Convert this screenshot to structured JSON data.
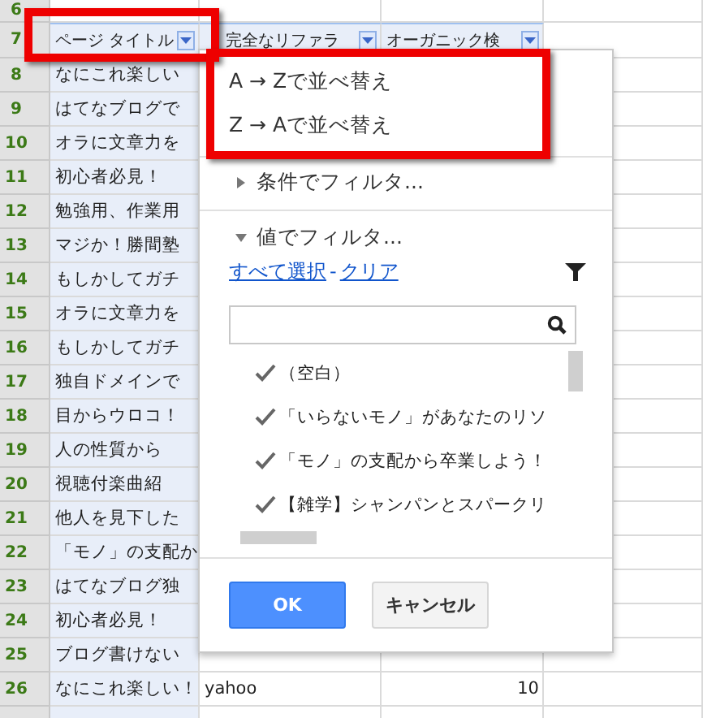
{
  "sheet": {
    "top_row_number": "6",
    "header": {
      "number": "7",
      "columns": [
        "ページ タイトル",
        "完全なリファラ",
        "オーガニック検"
      ]
    },
    "rows": [
      {
        "number": "8",
        "cells": [
          "なにこれ楽しい"
        ]
      },
      {
        "number": "9",
        "cells": [
          "はてなブログで"
        ]
      },
      {
        "number": "10",
        "cells": [
          "オラに文章力を"
        ]
      },
      {
        "number": "11",
        "cells": [
          "初心者必見！"
        ]
      },
      {
        "number": "12",
        "cells": [
          "勉強用、作業用"
        ]
      },
      {
        "number": "13",
        "cells": [
          "マジか！勝間塾"
        ]
      },
      {
        "number": "14",
        "cells": [
          "もしかしてガチ"
        ]
      },
      {
        "number": "15",
        "cells": [
          "オラに文章力を"
        ]
      },
      {
        "number": "16",
        "cells": [
          "もしかしてガチ"
        ]
      },
      {
        "number": "17",
        "cells": [
          "独自ドメインで"
        ]
      },
      {
        "number": "18",
        "cells": [
          "目からウロコ！"
        ]
      },
      {
        "number": "19",
        "cells": [
          "人の性質から"
        ]
      },
      {
        "number": "20",
        "cells": [
          "視聴付楽曲紹"
        ]
      },
      {
        "number": "21",
        "cells": [
          "他人を見下した"
        ]
      },
      {
        "number": "22",
        "cells": [
          "「モノ」の支配か"
        ]
      },
      {
        "number": "23",
        "cells": [
          "はてなブログ独"
        ]
      },
      {
        "number": "24",
        "cells": [
          "初心者必見！"
        ]
      },
      {
        "number": "25",
        "cells": [
          "ブログ書けない"
        ]
      },
      {
        "number": "26",
        "cells": [
          "なにこれ楽しい！",
          "yahoo",
          "10"
        ]
      }
    ]
  },
  "menu": {
    "sort_items": [
      "A → Zで並べ替え",
      "Z → Aで並べ替え"
    ],
    "sections": [
      {
        "label": "条件でフィルタ...",
        "expanded": false
      },
      {
        "label": "値でフィルタ...",
        "expanded": true
      }
    ],
    "select_all": "すべて選択",
    "separator": "-",
    "clear": "クリア",
    "values": [
      {
        "label": "（空白）",
        "checked": true
      },
      {
        "label": "「いらないモノ」があなたのリソ",
        "checked": true
      },
      {
        "label": "「モノ」の支配から卒業しよう！",
        "checked": true
      },
      {
        "label": "【雑学】シャンパンとスパークリ",
        "checked": true
      }
    ],
    "ok": "OK",
    "cancel": "キャンセル"
  }
}
